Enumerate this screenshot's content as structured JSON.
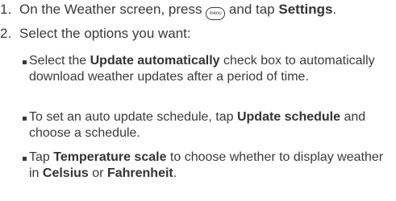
{
  "steps": [
    {
      "number": "1.",
      "t1": "On the Weather screen, press ",
      "icon": "menu-key-icon",
      "icon_text": "menu",
      "t2": " and tap ",
      "b1": "Settings",
      "t3": "."
    },
    {
      "number": "2.",
      "text": "Select the options you want:"
    }
  ],
  "bullets": [
    {
      "t1": "Select the ",
      "b1": "Update automatically",
      "t2": " check box to automatically download weather updates after a period of time."
    },
    {
      "t1": "To set an auto update schedule, tap ",
      "b1": "Update schedule",
      "t2": " and choose a schedule."
    },
    {
      "t1": "Tap ",
      "b1": "Temperature scale",
      "t2": " to choose whether to display weather in ",
      "b2": "Celsius",
      "t3": " or ",
      "b3": "Fahrenheit",
      "t4": "."
    }
  ]
}
